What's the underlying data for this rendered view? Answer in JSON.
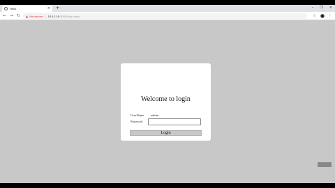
{
  "browser": {
    "tab_title": "Hello",
    "tab_close": "×",
    "new_tab": "+",
    "window_controls": [
      "–",
      "❐",
      "×"
    ],
    "nav": {
      "back": "←",
      "forward": "→",
      "reload": "↻"
    },
    "address": {
      "warning_icon": "warning-triangle-icon",
      "warning_glyph": "▲",
      "security_label": "Not secure",
      "separator": "|",
      "url_host": "10.0.1.10",
      "url_path": ":8080/login.aspx"
    },
    "star_glyph": "☆",
    "menu_glyph": "⋮"
  },
  "login": {
    "title": "Welcome to login",
    "username_label": "UserName",
    "username_value": "admin",
    "password_label": "Password",
    "password_value": "",
    "button_label": "Login"
  },
  "colors": {
    "page_background": "#c8c8c8",
    "card_background": "#ffffff",
    "not_secure": "#d93025"
  }
}
